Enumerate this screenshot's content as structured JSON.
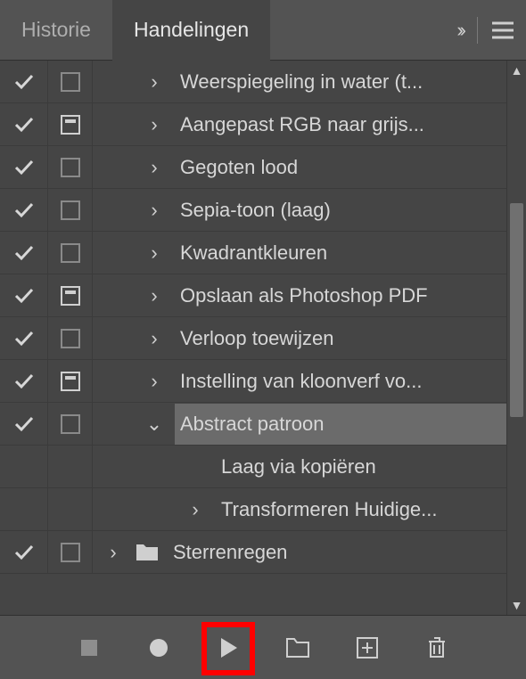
{
  "tabs": {
    "history": "Historie",
    "actions": "Handelingen"
  },
  "rows": [
    {
      "checked": true,
      "dialog": "empty",
      "indent": 1,
      "disclosure": "right",
      "label": "Weerspiegeling in water (t...",
      "selected": false
    },
    {
      "checked": true,
      "dialog": "dialog",
      "indent": 1,
      "disclosure": "right",
      "label": "Aangepast RGB naar grijs...",
      "selected": false
    },
    {
      "checked": true,
      "dialog": "empty",
      "indent": 1,
      "disclosure": "right",
      "label": "Gegoten lood",
      "selected": false
    },
    {
      "checked": true,
      "dialog": "empty",
      "indent": 1,
      "disclosure": "right",
      "label": "Sepia-toon (laag)",
      "selected": false
    },
    {
      "checked": true,
      "dialog": "empty",
      "indent": 1,
      "disclosure": "right",
      "label": "Kwadrantkleuren",
      "selected": false
    },
    {
      "checked": true,
      "dialog": "dialog",
      "indent": 1,
      "disclosure": "right",
      "label": "Opslaan als Photoshop PDF",
      "selected": false
    },
    {
      "checked": true,
      "dialog": "empty",
      "indent": 1,
      "disclosure": "right",
      "label": "Verloop toewijzen",
      "selected": false
    },
    {
      "checked": true,
      "dialog": "dialog",
      "indent": 1,
      "disclosure": "right",
      "label": "Instelling van kloonverf vo...",
      "selected": false
    },
    {
      "checked": true,
      "dialog": "empty",
      "indent": 1,
      "disclosure": "down",
      "label": "Abstract patroon",
      "selected": true
    },
    {
      "checked": false,
      "dialog": "none",
      "indent": 2,
      "disclosure": "none",
      "label": "Laag via kopiëren",
      "selected": false
    },
    {
      "checked": false,
      "dialog": "none",
      "indent": 2,
      "disclosure": "right",
      "label": "Transformeren Huidige...",
      "selected": false
    },
    {
      "checked": true,
      "dialog": "empty",
      "indent": 0,
      "disclosure": "right",
      "label": "Sterrenregen",
      "folder": true,
      "selected": false
    }
  ],
  "footer_icons": {
    "stop": "stop",
    "record": "record",
    "play": "play",
    "folder": "folder",
    "new": "new",
    "trash": "trash"
  }
}
